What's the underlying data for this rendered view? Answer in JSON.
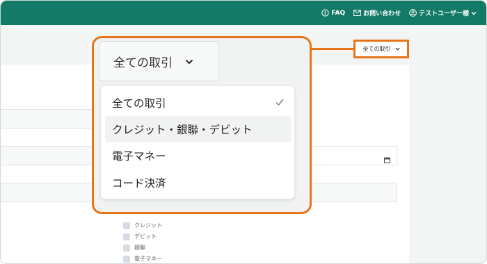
{
  "header": {
    "faq_label": "FAQ",
    "contact_label": "お問い合わせ",
    "user_label": "テストユーザー様"
  },
  "filter": {
    "selected": "全ての取引",
    "options": [
      {
        "label": "全ての取引",
        "checked": true
      },
      {
        "label": "クレジット・銀聯・デビット",
        "checked": false
      },
      {
        "label": "電子マネー",
        "checked": false
      },
      {
        "label": "コード決済",
        "checked": false
      }
    ]
  },
  "background_checkboxes": [
    "クレジット",
    "デビット",
    "銀聯",
    "電子マネー"
  ],
  "colors": {
    "header_bg": "#127a66",
    "highlight": "#e8741a"
  }
}
